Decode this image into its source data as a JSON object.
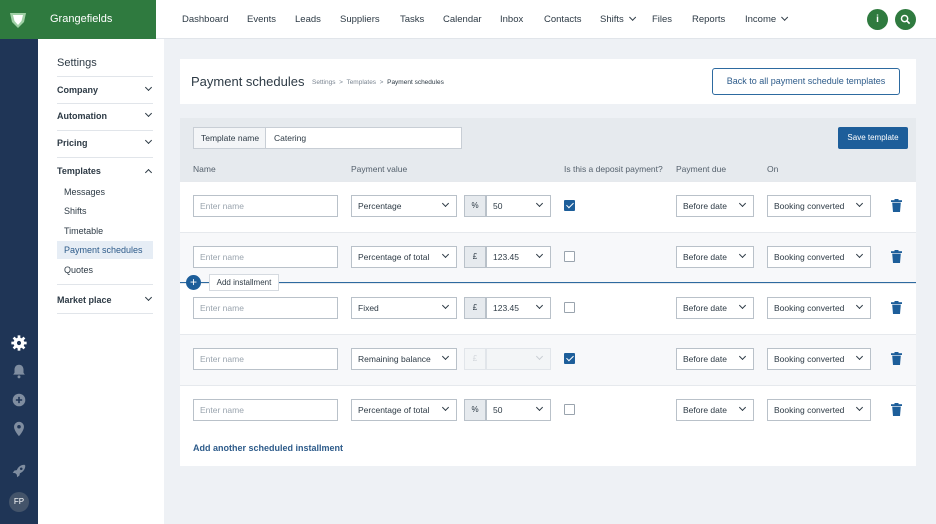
{
  "brand": {
    "name": "Grangefields"
  },
  "nav": {
    "items": [
      "Dashboard",
      "Events",
      "Leads",
      "Suppliers",
      "Tasks",
      "Calendar",
      "Inbox",
      "Contacts",
      "Shifts",
      "Files",
      "Reports",
      "Income"
    ],
    "info_label": "i"
  },
  "rail": {
    "avatar_initials": "FP"
  },
  "sidebar": {
    "title": "Settings",
    "sections": [
      "Company",
      "Automation",
      "Pricing",
      "Templates",
      "Market place"
    ],
    "templates_sub": [
      "Messages",
      "Shifts",
      "Timetable",
      "Payment schedules",
      "Quotes"
    ],
    "active_sub": "Payment schedules"
  },
  "header": {
    "title": "Payment schedules",
    "breadcrumb": [
      "Settings",
      "Templates",
      "Payment schedules"
    ],
    "back_button": "Back to all payment schedule templates"
  },
  "template": {
    "name_label": "Template name",
    "name_value": "Catering",
    "save_button": "Save template"
  },
  "columns": [
    "Name",
    "Payment value",
    "Is this a deposit payment?",
    "Payment due",
    "On"
  ],
  "rows": [
    {
      "name_placeholder": "Enter name",
      "value_type": "Percentage",
      "unit": "%",
      "amount": "50",
      "deposit": true,
      "due": "Before date",
      "on": "Booking converted"
    },
    {
      "name_placeholder": "Enter name",
      "value_type": "Percentage of total",
      "unit": "£",
      "amount": "123.45",
      "deposit": false,
      "due": "Before date",
      "on": "Booking converted"
    },
    {
      "name_placeholder": "Enter name",
      "value_type": "Fixed",
      "unit": "£",
      "amount": "123.45",
      "deposit": false,
      "due": "Before date",
      "on": "Booking converted"
    },
    {
      "name_placeholder": "Enter name",
      "value_type": "Remaining balance",
      "unit": "£",
      "amount": "",
      "deposit": true,
      "due": "Before date",
      "on": "Booking converted",
      "amount_disabled": true
    },
    {
      "name_placeholder": "Enter name",
      "value_type": "Percentage of total",
      "unit": "%",
      "amount": "50",
      "deposit": false,
      "due": "Before date",
      "on": "Booking converted"
    }
  ],
  "insert": {
    "label": "Add installment",
    "symbol": "+"
  },
  "add_link": "Add another scheduled installment",
  "colors": {
    "brand_green": "#2f7a3f",
    "rail_navy": "#1f3556",
    "primary_blue": "#1d5e9a"
  }
}
